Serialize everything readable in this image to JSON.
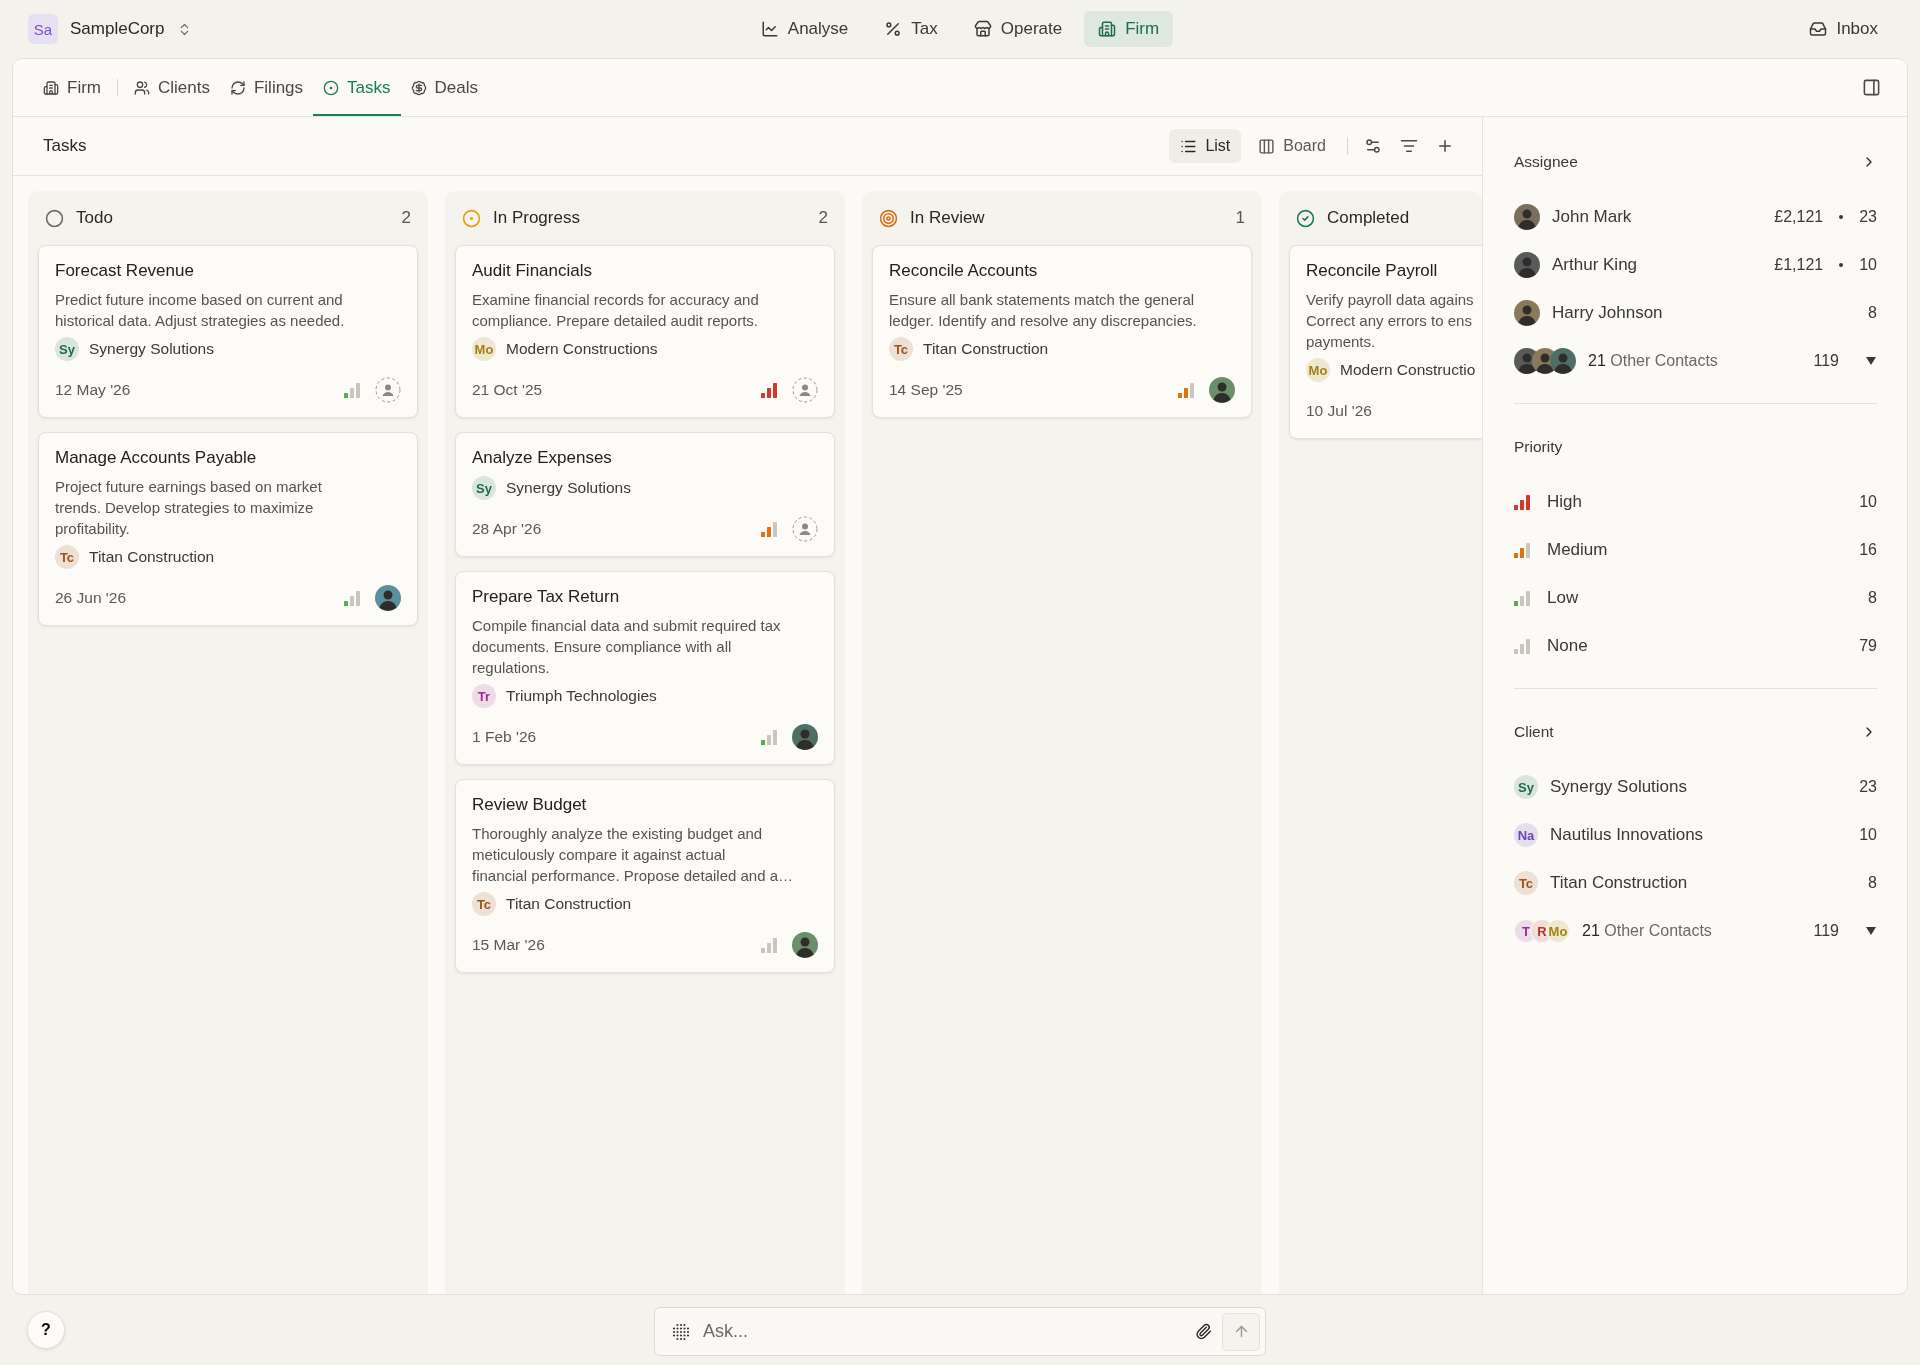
{
  "org": {
    "initials": "Sa",
    "name": "SampleCorp"
  },
  "nav": [
    {
      "label": "Analyse",
      "selected": false
    },
    {
      "label": "Tax",
      "selected": false
    },
    {
      "label": "Operate",
      "selected": false
    },
    {
      "label": "Firm",
      "selected": true
    }
  ],
  "inbox": "Inbox",
  "tabs": [
    {
      "label": "Firm",
      "selected": false
    },
    {
      "label": "Clients",
      "selected": false
    },
    {
      "label": "Filings",
      "selected": false
    },
    {
      "label": "Tasks",
      "selected": true
    },
    {
      "label": "Deals",
      "selected": false
    }
  ],
  "toolbar": {
    "title": "Tasks",
    "views": [
      {
        "label": "List",
        "selected": true
      },
      {
        "label": "Board",
        "selected": false
      }
    ]
  },
  "columns": [
    {
      "kind": "todo",
      "title": "Todo",
      "count": "2",
      "cards": [
        {
          "title": "Forecast Revenue",
          "description": [
            "Predict future income based on current and",
            "historical data. Adjust strategies as needed."
          ],
          "client": {
            "initials": "Sy",
            "name": "Synergy Solutions",
            "color": "#1e6b4f"
          },
          "date": "12 May '26",
          "priority": {
            "kind": "low"
          },
          "assigned": false
        },
        {
          "title": "Manage Accounts Payable",
          "description": [
            "Project future earnings based on market",
            "trends. Develop strategies to maximize",
            "profitability."
          ],
          "client": {
            "initials": "Tc",
            "name": "Titan Construction",
            "color": "#a0521c"
          },
          "date": "26 Jun '26",
          "priority": {
            "kind": "low"
          },
          "assigned": true
        }
      ]
    },
    {
      "kind": "in_progress",
      "title": "In Progress",
      "count": "2",
      "cards": [
        {
          "title": "Audit Financials",
          "description": [
            "Examine financial records for accuracy and",
            "compliance. Prepare detailed audit reports."
          ],
          "client": {
            "initials": "Mo",
            "name": "Modern Constructions",
            "color": "#a6800f"
          },
          "date": "21 Oct '25",
          "priority": {
            "kind": "high"
          },
          "assigned": false
        },
        {
          "title": "Analyze Expenses",
          "client": {
            "initials": "Sy",
            "name": "Synergy Solutions",
            "color": "#1e6b4f"
          },
          "date": "28 Apr '26",
          "priority": {
            "kind": "medium"
          },
          "assigned": false
        },
        {
          "title": "Prepare Tax Return",
          "description": [
            "Compile financial data and submit required tax",
            "documents. Ensure compliance with all",
            "regulations."
          ],
          "client": {
            "initials": "Tr",
            "name": "Triumph Technologies",
            "color": "#9b2a9b"
          },
          "date": "1 Feb '26",
          "priority": {
            "kind": "low"
          },
          "assigned": true
        },
        {
          "title": "Review Budget",
          "description": [
            "Thoroughly analyze the existing budget and",
            "meticulously compare it against actual",
            "financial performance. Propose detailed and a…"
          ],
          "client": {
            "initials": "Tc",
            "name": "Titan Construction",
            "color": "#a0521c"
          },
          "date": "15 Mar '26",
          "priority": {
            "kind": "none"
          },
          "assigned": true
        }
      ]
    },
    {
      "kind": "in_review",
      "title": "In Review",
      "count": "1",
      "cards": [
        {
          "title": "Reconcile Accounts",
          "description": [
            "Ensure all bank statements match the general",
            "ledger. Identify and resolve any discrepancies."
          ],
          "client": {
            "initials": "Tc",
            "name": "Titan Construction",
            "color": "#a0521c"
          },
          "date": "14 Sep '25",
          "priority": {
            "kind": "medium"
          },
          "assigned": true
        }
      ]
    },
    {
      "kind": "completed",
      "title": "Completed",
      "cards": [
        {
          "title": "Reconcile Payroll",
          "description": [
            "Verify payroll data agains",
            "Correct any errors to ens",
            "payments."
          ],
          "client": {
            "initials": "Mo",
            "name": "Modern Constructio",
            "color": "#a6800f"
          },
          "date": "10 Jul '26"
        }
      ]
    }
  ],
  "filters": {
    "assignee": {
      "title": "Assignee",
      "rows": [
        {
          "name": "John Mark",
          "amount": "£2,121",
          "count": "23"
        },
        {
          "name": "Arthur King",
          "amount": "£1,121",
          "count": "10"
        },
        {
          "name": "Harry Johnson",
          "count": "8"
        }
      ],
      "others": {
        "label": "**21** Other Contacts",
        "count": "119"
      }
    },
    "priority": {
      "title": "Priority",
      "rows": [
        {
          "kind": "high",
          "label": "High",
          "count": "10"
        },
        {
          "kind": "medium",
          "label": "Medium",
          "count": "16"
        },
        {
          "kind": "low",
          "label": "Low",
          "count": "8"
        },
        {
          "kind": "none",
          "label": "None",
          "count": "79"
        }
      ]
    },
    "client": {
      "title": "Client",
      "rows": [
        {
          "initials": "Sy",
          "name": "Synergy Solutions",
          "color": "#1e6b4f",
          "count": "23"
        },
        {
          "initials": "Na",
          "name": "Nautilus Innovations",
          "color": "#6a45b5",
          "count": "10"
        },
        {
          "initials": "Tc",
          "name": "Titan Construction",
          "color": "#a0521c",
          "count": "8"
        }
      ],
      "others": {
        "badges": [
          {
            "initials": "T",
            "color": "#9b2a9b"
          },
          {
            "initials": "R",
            "color": "#b03434"
          },
          {
            "initials": "Mo",
            "color": "#a6800f"
          }
        ],
        "label": "**21** Other Contacts",
        "count": "119"
      }
    }
  },
  "help": "?",
  "ask": {
    "placeholder": "Ask..."
  }
}
